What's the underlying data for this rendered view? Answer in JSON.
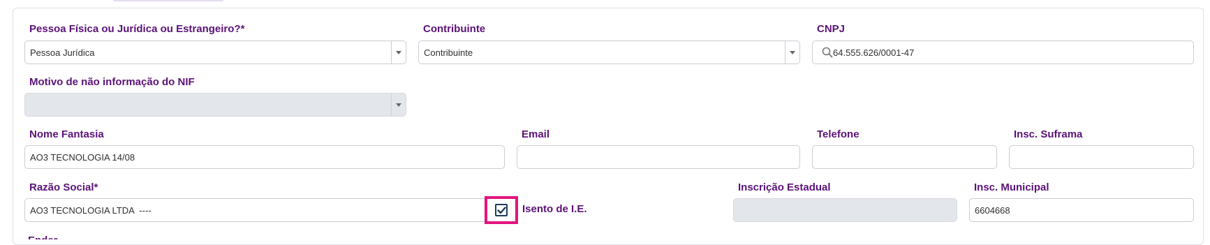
{
  "form": {
    "pessoa_tipo": {
      "label": "Pessoa Física ou Jurídica ou Estrangeiro?*",
      "value": "Pessoa Jurídica"
    },
    "contribuinte": {
      "label": "Contribuinte",
      "value": "Contribuinte"
    },
    "cnpj": {
      "label": "CNPJ",
      "value": "64.555.626/0001-47"
    },
    "motivo_nif": {
      "label": "Motivo de não informação do NIF",
      "value": ""
    },
    "nome_fantasia": {
      "label": "Nome Fantasia",
      "value": "AO3 TECNOLOGIA 14/08"
    },
    "email": {
      "label": "Email",
      "value": ""
    },
    "telefone": {
      "label": "Telefone",
      "value": ""
    },
    "insc_suframa": {
      "label": "Insc. Suframa",
      "value": ""
    },
    "razao_social": {
      "label": "Razão Social*",
      "value": "AO3 TECNOLOGIA LTDA  ----"
    },
    "isento_ie": {
      "label": "Isento de I.E.",
      "checked": true
    },
    "inscricao_estadual": {
      "label": "Inscrição Estadual",
      "value": ""
    },
    "insc_municipal": {
      "label": "Insc. Municipal",
      "value": "6604668"
    },
    "next_label_partial": "Ender"
  },
  "colors": {
    "label": "#5b1277",
    "highlight": "#e1157e",
    "disabled_bg": "#e3e6ea",
    "border": "#c9cdd4"
  },
  "icons": {
    "select_arrow": "chevron-down-icon",
    "search": "search-icon",
    "checkmark": "check-icon"
  }
}
